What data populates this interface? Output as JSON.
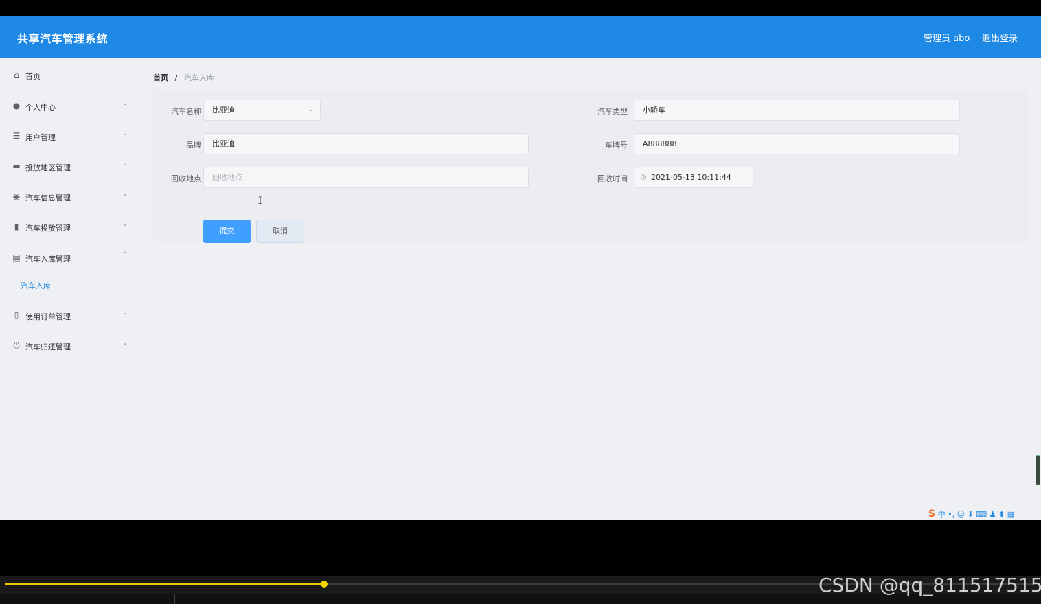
{
  "header": {
    "app_title": "共享汽车管理系统",
    "user_label": "管理员 abo",
    "logout_label": "退出登录"
  },
  "sidebar": {
    "items": [
      {
        "label": "首页",
        "icon": "home-icon",
        "has_arrow": false
      },
      {
        "label": "个人中心",
        "icon": "user-icon",
        "has_arrow": true
      },
      {
        "label": "用户管理",
        "icon": "list-icon",
        "has_arrow": true
      },
      {
        "label": "投放地区管理",
        "icon": "monitor-icon",
        "has_arrow": true
      },
      {
        "label": "汽车信息管理",
        "icon": "location-icon",
        "has_arrow": true
      },
      {
        "label": "汽车投放管理",
        "icon": "bar-chart-icon",
        "has_arrow": true
      },
      {
        "label": "汽车入库管理",
        "icon": "clipboard-icon",
        "has_arrow": true,
        "expanded": true
      },
      {
        "label": "使用订单管理",
        "icon": "phone-icon",
        "has_arrow": true
      },
      {
        "label": "汽车归还管理",
        "icon": "power-icon",
        "has_arrow": true
      }
    ],
    "submenu": {
      "label": "汽车入库",
      "active": true
    }
  },
  "breadcrumb": {
    "home": "首页",
    "separator": "/",
    "current": "汽车入库"
  },
  "form": {
    "car_name": {
      "label": "汽车名称",
      "value": "比亚迪"
    },
    "car_type": {
      "label": "汽车类型",
      "value": "小轿车"
    },
    "brand": {
      "label": "品牌",
      "value": "比亚迪"
    },
    "plate": {
      "label": "车牌号",
      "value": "A888888"
    },
    "recycle_place": {
      "label": "回收地点",
      "value": "",
      "placeholder": "回收地点"
    },
    "recycle_time": {
      "label": "回收时间",
      "value": "2021-05-13 10:11:44"
    },
    "submit_label": "提交",
    "cancel_label": "取消"
  },
  "ime": {
    "text": "中 •, ☺ ⬇ ⌨ ♟ ⬆ ▦"
  },
  "player": {
    "progress": 0.31
  },
  "watermark": "CSDN @qq_811517515",
  "colors": {
    "primary": "#1e88e5",
    "button": "#409eff",
    "background": "#eef0f3"
  }
}
